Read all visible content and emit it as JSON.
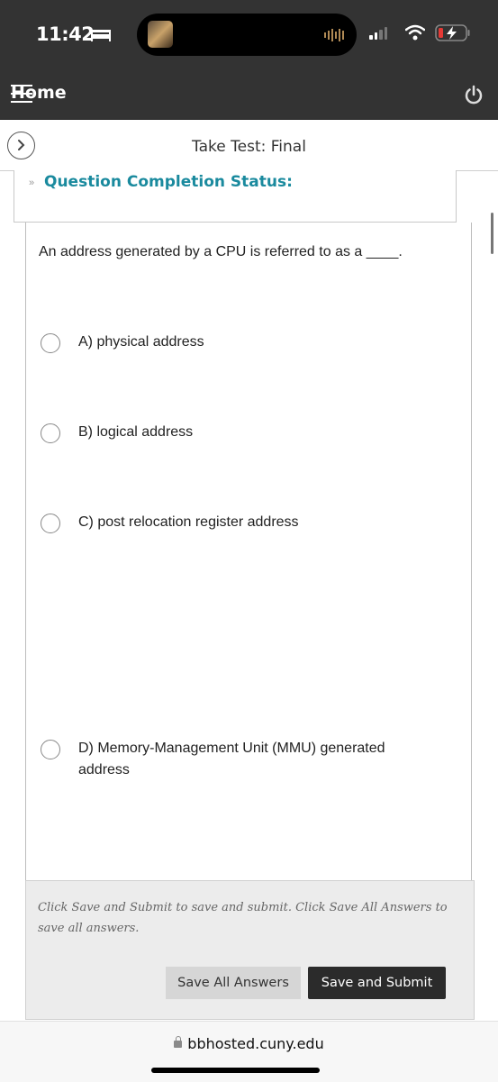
{
  "status_bar": {
    "time": "11:42",
    "sleep_icon": "bed-icon",
    "signal_icon": "cellular-signal-icon",
    "wifi_icon": "wifi-icon",
    "battery_icon": "battery-charging-icon",
    "battery_color": "#e53935"
  },
  "top_bar": {
    "home_label": "Home",
    "menu_icon": "hamburger-menu-icon",
    "power_icon": "power-icon"
  },
  "title_bar": {
    "nav_icon": "chevron-right-icon",
    "title": "Take Test: Final"
  },
  "completion_status": {
    "toggle_icon": "double-chevron-down-icon",
    "label": "Question Completion Status:",
    "color": "#1a8a9e"
  },
  "question": {
    "text": "An address generated by a CPU is referred to as a ____.",
    "options": [
      {
        "label": "A)  physical address",
        "selected": false
      },
      {
        "label": "B)  logical address",
        "selected": false
      },
      {
        "label": "C)  post relocation register address",
        "selected": false
      },
      {
        "label": "D) Memory-Management Unit (MMU) generated address",
        "selected": false
      }
    ]
  },
  "footer": {
    "note": "Click Save and Submit to save and submit. Click Save All Answers to save all answers.",
    "save_all_label": "Save All Answers",
    "save_submit_label": "Save and Submit"
  },
  "browser": {
    "url": "bbhosted.cuny.edu",
    "lock_icon": "lock-icon"
  }
}
